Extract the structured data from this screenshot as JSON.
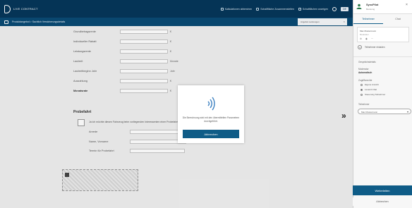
{
  "header": {
    "app_name": "LIVE CONTRACT",
    "actions": [
      "Kalkulationen abbrechen",
      "Schaltfläche Zusammenstellen",
      "Schaltflächen anzeigen"
    ],
    "select_value": "DE"
  },
  "subbar": {
    "breadcrumb": "Produktangebot  >  Sachlich Versicherungsdetails",
    "tab_label": "Angebot Leistungen"
  },
  "form": {
    "rows": [
      {
        "label": "Grundbetragsrente",
        "unit": "€"
      },
      {
        "label": "Individueller Rabatt",
        "unit": "€"
      },
      {
        "label": "Leistungsrente",
        "unit": "€"
      },
      {
        "label": "Laufzeit",
        "unit": "Monate"
      },
      {
        "label": "Laufzeitbeginn Jahr",
        "unit": "Jahr"
      },
      {
        "label": "Auszahlung",
        "unit": "€"
      },
      {
        "label": "Monatsrate",
        "unit": "€"
      }
    ],
    "section_title": "Probefahrt",
    "checkbox_text": "Ja ich möchte diesen Fahrzeug beim vorliegenden Interessenten einer Probefahrt anbieten",
    "sub_rows": [
      {
        "label": "Anrede"
      },
      {
        "label": "Name, Vorname"
      },
      {
        "label": "Termin für Probefahrt"
      }
    ]
  },
  "dialog": {
    "message": "Die Berechnung wird mit den übermittelten Parametern durchgeführt.",
    "button_label": "Abbrechen"
  },
  "panel": {
    "user_name": "SyncPilot",
    "user_sub": "Beratung",
    "tabs": [
      "Teilnehmer",
      "Chat"
    ],
    "card_title": "Max Mustermann",
    "card_sub": "Moderator",
    "card_controls": "⊘ ◉ ⋯",
    "add_label": "Teilnehmer einladen",
    "section_label": "Gesprächsdetails",
    "moderator_label": "Moderator",
    "moderator_value": "Automatisch",
    "access_label": "Zugriffsrechte",
    "radios": [
      "Eigene Ansicht",
      "Lesend Chat",
      "Steuerung Teilnehmer"
    ],
    "select_label": "Teilnehmer",
    "select_value": "Max Mustermann",
    "primary_label": "Weiterleiten",
    "secondary_label": "Abbrechen"
  }
}
